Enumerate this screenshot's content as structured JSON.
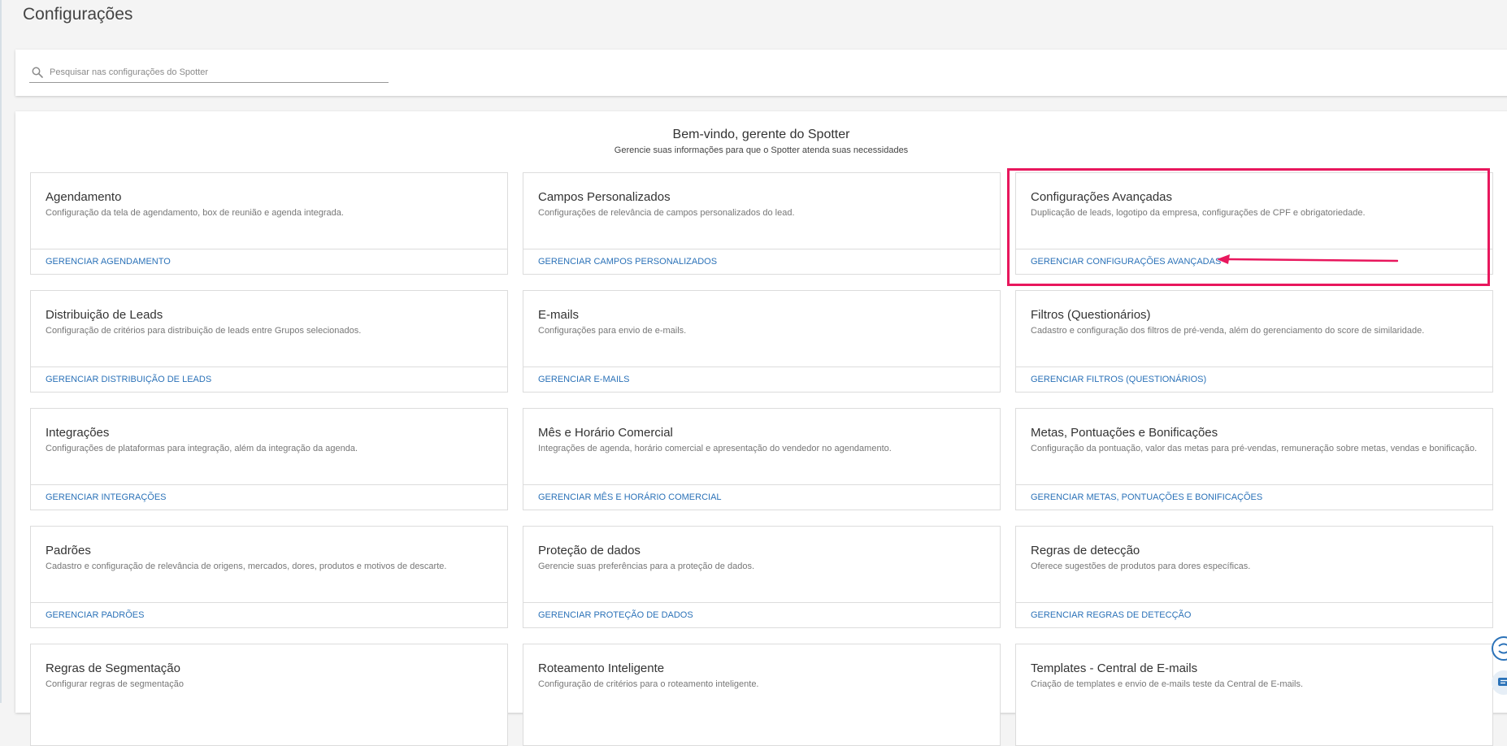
{
  "page": {
    "title": "Configurações"
  },
  "search": {
    "placeholder": "Pesquisar nas configurações do Spotter"
  },
  "welcome": {
    "title": "Bem-vindo, gerente do Spotter",
    "subtitle": "Gerencie suas informações para que o Spotter atenda suas necessidades"
  },
  "colors": {
    "link": "#2b72b8",
    "highlight": "#e8175d"
  },
  "tiles": [
    {
      "title": "Agendamento",
      "desc": "Configuração da tela de agendamento, box de reunião e agenda integrada.",
      "link": "GERENCIAR AGENDAMENTO"
    },
    {
      "title": "Campos Personalizados",
      "desc": "Configurações de relevância de campos personalizados do lead.",
      "link": "GERENCIAR CAMPOS PERSONALIZADOS"
    },
    {
      "title": "Configurações Avançadas",
      "desc": "Duplicação de leads, logotipo da empresa, configurações de CPF e obrigatoriedade.",
      "link": "GERENCIAR CONFIGURAÇÕES AVANÇADAS"
    },
    {
      "title": "Distribuição de Leads",
      "desc": "Configuração de critérios para distribuição de leads entre Grupos selecionados.",
      "link": "GERENCIAR DISTRIBUIÇÃO DE LEADS"
    },
    {
      "title": "E-mails",
      "desc": "Configurações para envio de e-mails.",
      "link": "GERENCIAR E-MAILS"
    },
    {
      "title": "Filtros (Questionários)",
      "desc": "Cadastro e configuração dos filtros de pré-venda, além do gerenciamento do score de similaridade.",
      "link": "GERENCIAR FILTROS (QUESTIONÁRIOS)"
    },
    {
      "title": "Integrações",
      "desc": "Configurações de plataformas para integração, além da integração da agenda.",
      "link": "GERENCIAR INTEGRAÇÕES"
    },
    {
      "title": "Mês e Horário Comercial",
      "desc": "Integrações de agenda, horário comercial e apresentação do vendedor no agendamento.",
      "link": "GERENCIAR MÊS E HORÁRIO COMERCIAL"
    },
    {
      "title": "Metas, Pontuações e Bonificações",
      "desc": "Configuração da pontuação, valor das metas para pré-vendas, remuneração sobre metas, vendas e bonificação.",
      "link": "GERENCIAR METAS, PONTUAÇÕES E BONIFICAÇÕES"
    },
    {
      "title": "Padrões",
      "desc": "Cadastro e configuração de relevância de origens, mercados, dores, produtos e motivos de descarte.",
      "link": "GERENCIAR PADRÕES"
    },
    {
      "title": "Proteção de dados",
      "desc": "Gerencie suas preferências para a proteção de dados.",
      "link": "GERENCIAR PROTEÇÃO DE DADOS"
    },
    {
      "title": "Regras de detecção",
      "desc": "Oferece sugestões de produtos para dores específicas.",
      "link": "GERENCIAR REGRAS DE DETECÇÃO"
    },
    {
      "title": "Regras de Segmentação",
      "desc": "Configurar regras de segmentação",
      "link": ""
    },
    {
      "title": "Roteamento Inteligente",
      "desc": "Configuração de critérios para o roteamento inteligente.",
      "link": ""
    },
    {
      "title": "Templates - Central de E-mails",
      "desc": "Criação de templates e envio de e-mails teste da Central de E-mails.",
      "link": ""
    }
  ],
  "icons": {
    "search": "search-icon",
    "chat": "chat-icon",
    "help": "help-icon"
  }
}
